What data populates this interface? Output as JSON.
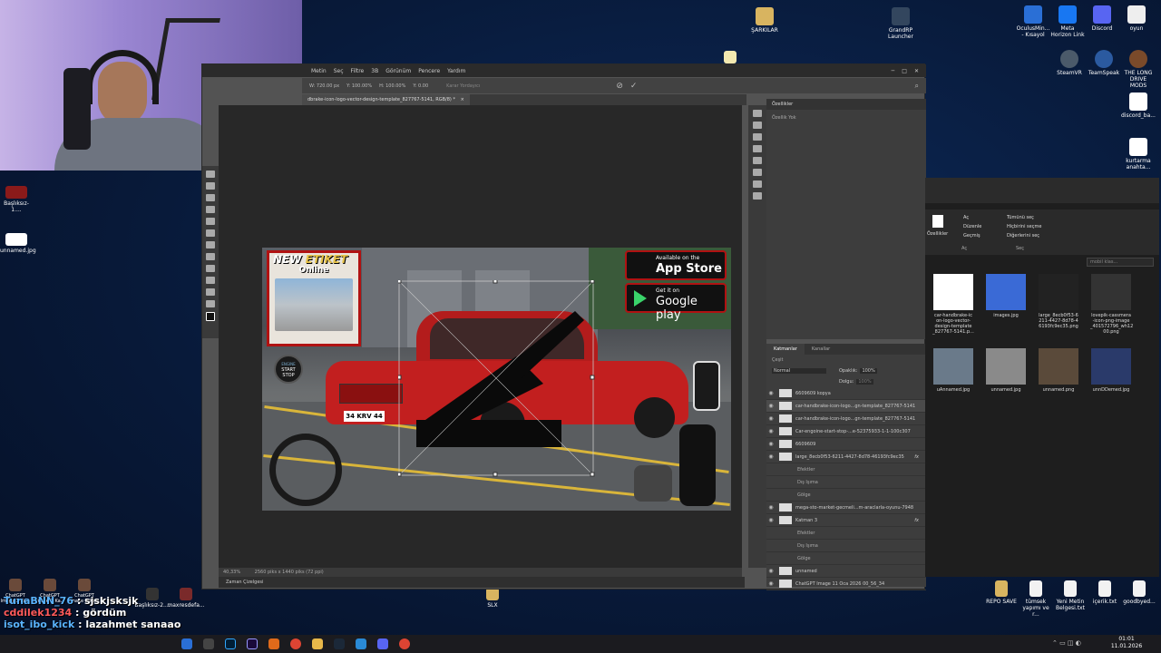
{
  "desktop": {
    "icons_right_top": [
      {
        "label": "OculusMin...\n- Kısayol",
        "color": "#2a6fd6"
      },
      {
        "label": "Meta\nHorizon Link",
        "color": "#1877f2"
      },
      {
        "label": "Discord",
        "color": "#5865f2"
      },
      {
        "label": "oyun",
        "color": "#eeeeee"
      }
    ],
    "icons_right_row2": [
      {
        "label": "SteamVR",
        "color": "#4b5a6a"
      },
      {
        "label": "TeamSpeak",
        "color": "#2b5aa0"
      },
      {
        "label": "THE LONG\nDRIVE MODS",
        "color": "#7a4a2a"
      }
    ],
    "icon_sarkilar": "ŞARKILAR",
    "icon_grandrp": "GrandRP\nLauncher",
    "icon_discord_ba": "discord_ba...",
    "icon_kurtarma": "kurtarma\nanahta...",
    "left_icons": [
      {
        "label": "Başlıksız-1....",
        "color": "#8a1a1a"
      },
      {
        "label": "unnamed.jpg",
        "color": "#ffffff"
      }
    ],
    "bottom_right_icons": [
      {
        "label": "REPO SAVE"
      },
      {
        "label": "tümsek\nyapımı ve r..."
      },
      {
        "label": "Yeni Metin\nBelgesi.txt"
      },
      {
        "label": "içerik.txt"
      },
      {
        "label": "goodbyed..."
      }
    ],
    "bottom_center_icon": "SLX",
    "bottom_left_icons": [
      "Başlıksız-2....",
      "maxresdefa..."
    ],
    "bottom_left_small": [
      "ChatGPT\nImage 3 Ka...",
      "ChatGPT\nImage 3 Ka...",
      "ChatGPT\nImage 3 Ka..."
    ]
  },
  "photoshop": {
    "menu": [
      "Metin",
      "Seç",
      "Filtre",
      "3B",
      "Görünüm",
      "Pencere",
      "Yardım"
    ],
    "options_fields": [
      "W: 720.00 px",
      "Y: 100.00%",
      "H: 100.00%",
      "Y: 0.00"
    ],
    "options_hint": "Karar Yordayıcı",
    "doc_tab": "dbrake-icon-logo-vector-design-template_827767-5141, RGB/8) *",
    "status_zoom": "40,33%",
    "status_size": "2560 piks x 1440 piks (72 ppi)",
    "timeline_label": "Zaman Çizelgesi",
    "properties_title": "Özellikler",
    "properties_empty": "Özellik Yok",
    "layers_tab": "Katmanlar",
    "channels_tab": "Kanallar",
    "blend_mode": "Normal",
    "opacity_label": "Opaklık:",
    "opacity_value": "100%",
    "fill_label": "Dolgu:",
    "fill_value": "100%",
    "search_placeholder": "Çeşit",
    "layers": [
      {
        "name": "6609609 kopya",
        "fx": ""
      },
      {
        "name": "car-handbrake-icon-logo...gn-template_827767-5141",
        "fx": ""
      },
      {
        "name": "car-handbrake-icon-logo...gn-template_827767-5141",
        "fx": ""
      },
      {
        "name": "Car-engoine-start-stop-...e-52375933-1-1-100c307",
        "fx": ""
      },
      {
        "name": "6609609",
        "fx": ""
      },
      {
        "name": "large_8ecb0f53-6211-4427-8d78-46193fc9ec35",
        "fx": "fx"
      },
      {
        "name": "Efektler",
        "fx": ""
      },
      {
        "name": "Dış Işıma",
        "fx": ""
      },
      {
        "name": "Gölge",
        "fx": ""
      },
      {
        "name": "mega-sto-market-gecmeli...m-araclarla-oyunu-7948",
        "fx": ""
      },
      {
        "name": "Katman 3",
        "fx": "fx"
      },
      {
        "name": "Efektler",
        "fx": ""
      },
      {
        "name": "Dış Işıma",
        "fx": ""
      },
      {
        "name": "Gölge",
        "fx": ""
      },
      {
        "name": "unnamed",
        "fx": ""
      },
      {
        "name": "ChatGPT Image 11 Oca 2026 00_56_34",
        "fx": ""
      }
    ],
    "artwork": {
      "new_etiket_1": "NEW",
      "new_etiket_2": "ETIKET",
      "online": "Online",
      "start_stop_1": "START",
      "start_stop_2": "STOP",
      "engine": "ENGINE",
      "appstore_small": "Available on the",
      "appstore_big": "App Store",
      "googleplay_small": "Get it on",
      "googleplay_big": "Google play",
      "plate": "34 KRV 44"
    }
  },
  "explorer": {
    "ribbon": {
      "open": "Aç",
      "edit": "Düzenle",
      "history": "Geçmiş",
      "properties": "Özellikler",
      "select_all": "Tümünü seç",
      "select_none": "Hiçbirini seçme",
      "invert": "Diğerlerini seç",
      "group_open": "Aç",
      "group_select": "Seç"
    },
    "search_placeholder": "mobil klas...",
    "files": [
      {
        "label": "car-handbrake-ic\non-logo-vector-\ndesign-template\n_827767-5141.p...",
        "color": "#ffffff"
      },
      {
        "label": "images.jpg",
        "color": "#3a6ad6"
      },
      {
        "label": "large_8ecb0f53-6\n211-4427-8d78-4\n6193fc9ec35.png",
        "color": "#222222"
      },
      {
        "label": "lovepik-cassmera\n-icon-png-image\n_401572796_wh12\n00.png",
        "color": "#333333"
      },
      {
        "label": "uAnnamed.jpg",
        "color": "#6a7a8a"
      },
      {
        "label": "unnamed.jpg",
        "color": "#8a8a8a"
      },
      {
        "label": "unnamed.png",
        "color": "#5a4a3a"
      },
      {
        "label": "unnDDemed.jpg",
        "color": "#2a3a6a"
      }
    ]
  },
  "chat": [
    {
      "user": "TunaBNN_76",
      "message": "sjskjsksjk",
      "color": "#5ab4ff"
    },
    {
      "user": "cddilek1234",
      "message": "gördüm",
      "color": "#ff5a5a"
    },
    {
      "user": "isot_ibo_kick",
      "message": "lazahmet sanaao",
      "color": "#5ab4ff"
    }
  ],
  "taskbar": {
    "time": "01:01",
    "date": "11.01.2026"
  }
}
